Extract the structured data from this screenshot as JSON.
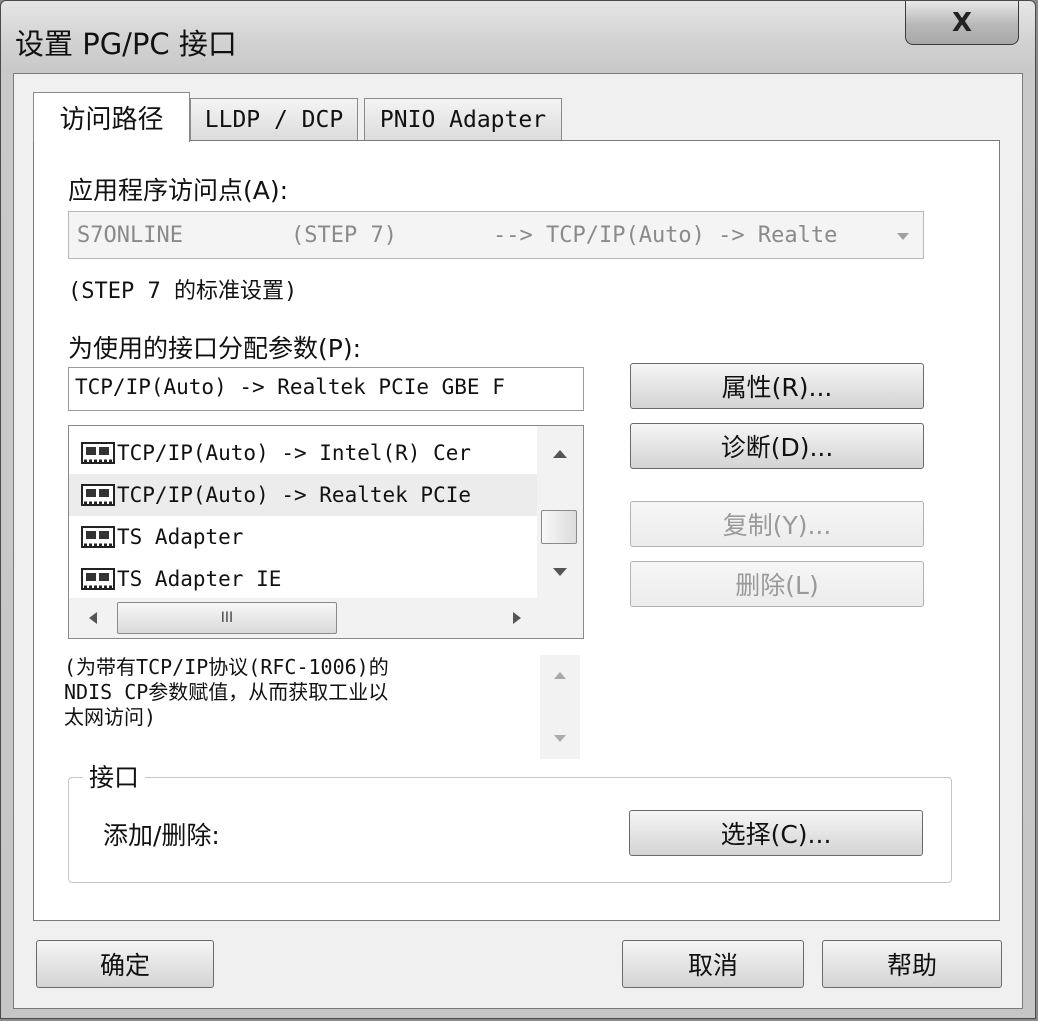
{
  "window": {
    "title": "设置 PG/PC 接口",
    "close_glyph": "X"
  },
  "tabs": [
    {
      "label": "访问路径",
      "active": true
    },
    {
      "label": "LLDP / DCP",
      "active": false
    },
    {
      "label": "PNIO Adapter",
      "active": false
    }
  ],
  "access_point": {
    "label": "应用程序访问点(A):",
    "value_name": "S7ONLINE",
    "value_app": "(STEP 7)",
    "value_path": "--> TCP/IP(Auto) -> Realte",
    "note": "(STEP 7 的标准设置)"
  },
  "interface_params": {
    "label": "为使用的接口分配参数(P):",
    "value": "TCP/IP(Auto) -> Realtek PCIe GBE F"
  },
  "interface_list": {
    "items": [
      {
        "label": "TCP/IP(Auto) -> Intel(R) Cer",
        "selected": false
      },
      {
        "label": "TCP/IP(Auto) -> Realtek PCIe",
        "selected": true
      },
      {
        "label": "TS Adapter",
        "selected": false
      },
      {
        "label": "TS Adapter IE",
        "selected": false
      }
    ],
    "hscroll_thumb_glyph": "III"
  },
  "buttons": {
    "properties": "属性(R)...",
    "diagnostics": "诊断(D)...",
    "copy": "复制(Y)...",
    "delete": "删除(L)",
    "select": "选择(C)...",
    "ok": "确定",
    "cancel": "取消",
    "help": "帮助"
  },
  "description": {
    "line1": "(为带有TCP/IP协议(RFC-1006)的",
    "line2": "NDIS CP参数赋值，从而获取工业以",
    "line3": "太网访问)"
  },
  "interfaces_group": {
    "title": "接口",
    "add_remove_label": "添加/删除:"
  }
}
